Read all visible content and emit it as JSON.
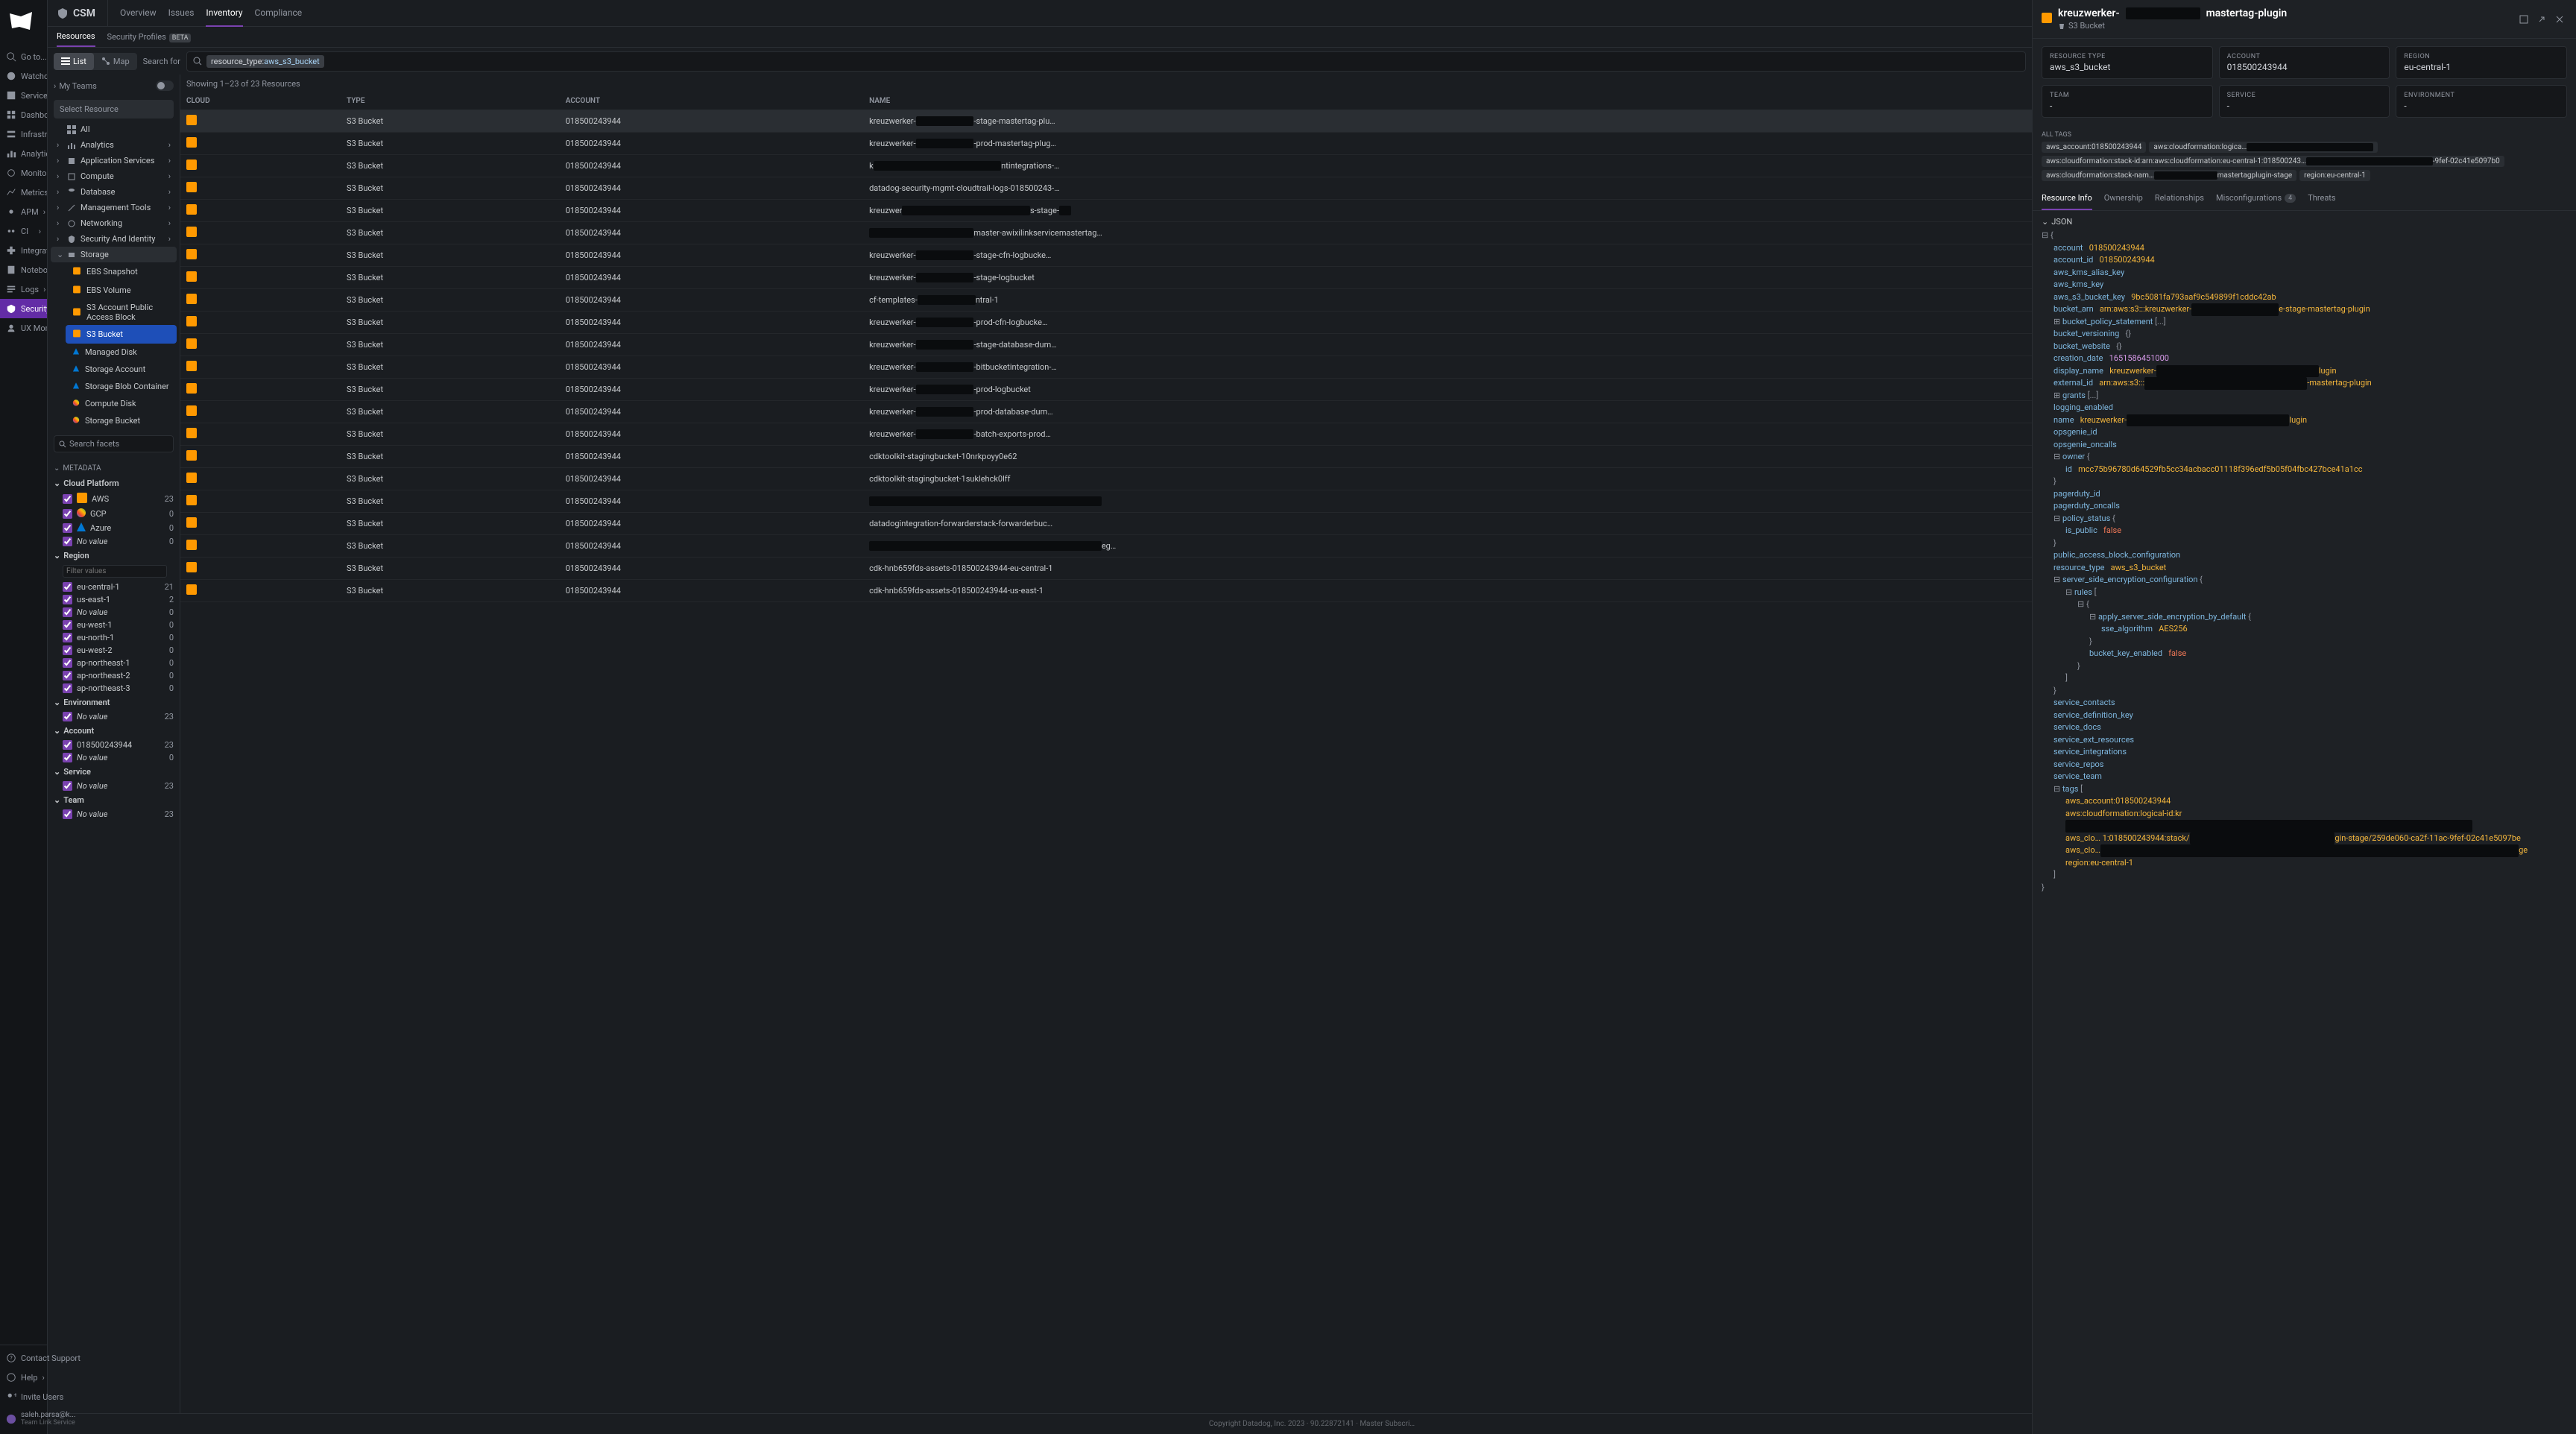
{
  "nav": {
    "items": [
      "Go to...",
      "Watchdog",
      "Service Mgmt",
      "Dashboards",
      "Infrastructure",
      "Analytics",
      "Monitors",
      "Metrics",
      "APM",
      "CI",
      "Integrations",
      "Notebooks",
      "Logs",
      "Security",
      "UX Monitoring"
    ],
    "bottom": [
      "Contact Support",
      "Help",
      "Invite Users"
    ],
    "user_email": "saleh.parsa@k...",
    "service_name": "Team Link Service"
  },
  "header": {
    "title": "CSM",
    "tabs": [
      "Overview",
      "Issues",
      "Inventory",
      "Compliance"
    ],
    "active_tab": "Inventory",
    "sub_tabs": [
      "Resources",
      "Security Profiles"
    ],
    "active_sub_tab": "Resources",
    "beta_label": "BETA"
  },
  "toolbar": {
    "view_list": "List",
    "view_map": "Map",
    "search_label": "Search for",
    "filter_key": "resource_type",
    "filter_value": "aws_s3_bucket"
  },
  "sidebar": {
    "breadcrumb_label": "My Teams",
    "select_resource": "Select Resource",
    "tree": [
      {
        "label": "All",
        "expandable": false
      },
      {
        "label": "Analytics",
        "expandable": true
      },
      {
        "label": "Application Services",
        "expandable": true
      },
      {
        "label": "Compute",
        "expandable": true
      },
      {
        "label": "Database",
        "expandable": true
      },
      {
        "label": "Management Tools",
        "expandable": true
      },
      {
        "label": "Networking",
        "expandable": true
      },
      {
        "label": "Security And Identity",
        "expandable": true
      },
      {
        "label": "Storage",
        "expandable": true,
        "active": true,
        "children": [
          {
            "label": "EBS Snapshot"
          },
          {
            "label": "EBS Volume"
          },
          {
            "label": "S3 Account Public Access Block"
          },
          {
            "label": "S3 Bucket",
            "active": true
          },
          {
            "label": "Managed Disk"
          },
          {
            "label": "Storage Account"
          },
          {
            "label": "Storage Blob Container"
          },
          {
            "label": "Compute Disk"
          },
          {
            "label": "Storage Bucket"
          }
        ]
      }
    ],
    "facet_search_placeholder": "Search facets",
    "metadata_label": "METADATA",
    "facets": {
      "cloud_platform": {
        "label": "Cloud Platform",
        "items": [
          {
            "name": "AWS",
            "count": 23,
            "icon": "aws"
          },
          {
            "name": "GCP",
            "count": 0,
            "icon": "gcp"
          },
          {
            "name": "Azure",
            "count": 0,
            "icon": "azure"
          },
          {
            "name": "No value",
            "count": 0
          }
        ]
      },
      "region": {
        "label": "Region",
        "filter_placeholder": "Filter values",
        "items": [
          {
            "name": "eu-central-1",
            "count": 21
          },
          {
            "name": "us-east-1",
            "count": 2
          },
          {
            "name": "No value",
            "count": 0
          },
          {
            "name": "eu-west-1",
            "count": 0
          },
          {
            "name": "eu-north-1",
            "count": 0
          },
          {
            "name": "eu-west-2",
            "count": 0
          },
          {
            "name": "ap-northeast-1",
            "count": 0
          },
          {
            "name": "ap-northeast-2",
            "count": 0
          },
          {
            "name": "ap-northeast-3",
            "count": 0
          }
        ]
      },
      "environment": {
        "label": "Environment",
        "items": [
          {
            "name": "No value",
            "count": 23
          }
        ]
      },
      "account": {
        "label": "Account",
        "items": [
          {
            "name": "018500243944",
            "count": 23
          },
          {
            "name": "No value",
            "count": 0
          }
        ]
      },
      "service": {
        "label": "Service",
        "items": [
          {
            "name": "No value",
            "count": 23
          }
        ]
      },
      "team": {
        "label": "Team",
        "items": [
          {
            "name": "No value",
            "count": 23
          }
        ]
      }
    }
  },
  "results": {
    "summary": "Showing 1–23 of 23 Resources",
    "columns": [
      "CLOUD",
      "TYPE",
      "ACCOUNT",
      "NAME"
    ],
    "rows": [
      {
        "type": "S3 Bucket",
        "account": "018500243944",
        "name": "kreuzwerker-██████████-stage-mastertag-plu…",
        "selected": true
      },
      {
        "type": "S3 Bucket",
        "account": "018500243944",
        "name": "kreuzwerker-██████████-prod-mastertag-plug…"
      },
      {
        "type": "S3 Bucket",
        "account": "018500243944",
        "name": "k██████████████████████ntintegrations-…"
      },
      {
        "type": "S3 Bucket",
        "account": "018500243944",
        "name": "datadog-security-mgmt-cloudtrail-logs-018500243-…"
      },
      {
        "type": "S3 Bucket",
        "account": "018500243944",
        "name": "kreuzwer██████████████████████s-stage-██"
      },
      {
        "type": "S3 Bucket",
        "account": "018500243944",
        "name": "██████████████████master-awixilinkservicemastertag…"
      },
      {
        "type": "S3 Bucket",
        "account": "018500243944",
        "name": "kreuzwerker-██████████-stage-cfn-logbucke…"
      },
      {
        "type": "S3 Bucket",
        "account": "018500243944",
        "name": "kreuzwerker-██████████-stage-logbucket"
      },
      {
        "type": "S3 Bucket",
        "account": "018500243944",
        "name": "cf-templates-██████████ntral-1"
      },
      {
        "type": "S3 Bucket",
        "account": "018500243944",
        "name": "kreuzwerker-██████████-prod-cfn-logbucke…"
      },
      {
        "type": "S3 Bucket",
        "account": "018500243944",
        "name": "kreuzwerker-██████████-stage-database-dum…"
      },
      {
        "type": "S3 Bucket",
        "account": "018500243944",
        "name": "kreuzwerker-██████████-bitbucketintegration-…"
      },
      {
        "type": "S3 Bucket",
        "account": "018500243944",
        "name": "kreuzwerker-██████████-prod-logbucket"
      },
      {
        "type": "S3 Bucket",
        "account": "018500243944",
        "name": "kreuzwerker-██████████-prod-database-dum…"
      },
      {
        "type": "S3 Bucket",
        "account": "018500243944",
        "name": "kreuzwerker-██████████-batch-exports-prod…"
      },
      {
        "type": "S3 Bucket",
        "account": "018500243944",
        "name": "cdktoolkit-stagingbucket-10nrkpoyy0e62"
      },
      {
        "type": "S3 Bucket",
        "account": "018500243944",
        "name": "cdktoolkit-stagingbucket-1suklehck0lff"
      },
      {
        "type": "S3 Bucket",
        "account": "018500243944",
        "name": "████████████████████████████████████████"
      },
      {
        "type": "S3 Bucket",
        "account": "018500243944",
        "name": "datadogintegration-forwarderstack-forwarderbuc…"
      },
      {
        "type": "S3 Bucket",
        "account": "018500243944",
        "name": "████████████████████████████████████████eg…"
      },
      {
        "type": "S3 Bucket",
        "account": "018500243944",
        "name": "cdk-hnb659fds-assets-018500243944-eu-central-1"
      },
      {
        "type": "S3 Bucket",
        "account": "018500243944",
        "name": "cdk-hnb659fds-assets-018500243944-us-east-1"
      }
    ]
  },
  "detail": {
    "title_prefix": "kreuzwerker-",
    "title_suffix": "mastertag-plugin",
    "subtitle": "S3 Bucket",
    "metadata": {
      "resource_type": {
        "label": "RESOURCE TYPE",
        "value": "aws_s3_bucket"
      },
      "account": {
        "label": "ACCOUNT",
        "value": "018500243944"
      },
      "region": {
        "label": "REGION",
        "value": "eu-central-1"
      },
      "team": {
        "label": "TEAM",
        "value": "-"
      },
      "service": {
        "label": "SERVICE",
        "value": "-"
      },
      "environment": {
        "label": "ENVIRONMENT",
        "value": "-"
      }
    },
    "all_tags_label": "ALL TAGS",
    "tags": [
      "aws_account:018500243944",
      "aws:cloudformation:logica…████████████████████████",
      "aws:cloudformation:stack-id:arn:aws:cloudformation:eu-central-1:018500243…████████████████████████-9fef-02c41e5097b0",
      "aws:cloudformation:stack-nam…████████████mastertagplugin-stage",
      "region:eu-central-1"
    ],
    "tabs": [
      {
        "label": "Resource Info",
        "active": true
      },
      {
        "label": "Ownership"
      },
      {
        "label": "Relationships"
      },
      {
        "label": "Misconfigurations",
        "badge": "4"
      },
      {
        "label": "Threats"
      }
    ],
    "json_label": "JSON",
    "json": {
      "account": "018500243944",
      "account_id": "018500243944",
      "aws_kms_alias_key": "",
      "aws_kms_key": "",
      "aws_s3_bucket_key": "9bc5081fa793aaf9c549899f1cddc42ab",
      "bucket_arn": "arn:aws:s3:::kreuzwerker-███████████████e-stage-mastertag-plugin",
      "bucket_policy_statement_ellipsis": "[...]",
      "bucket_versioning": "{}",
      "bucket_website": "{}",
      "creation_date": "1651586451000",
      "display_name": "kreuzwerker-████████████████████████████lugin",
      "external_id": "arn:aws:s3:::████████████████████████████-mastertag-plugin",
      "grants_ellipsis": "[...]",
      "logging_enabled": "",
      "name": "kreuzwerker-████████████████████████████lugin",
      "opsgenie_id": "",
      "opsgenie_oncalls": "",
      "owner_id": "mcc75b96780d64529fb5cc34acbacc01118f396edf5b05f04fbc427bce41a1cc",
      "pagerduty_id": "",
      "pagerduty_oncalls": "",
      "is_public": "false",
      "public_access_block_configuration": "",
      "resource_type": "aws_s3_bucket",
      "sse_algorithm": "AES256",
      "bucket_key_enabled": "false",
      "service_contacts": "",
      "service_definition_key": "",
      "service_docs": "",
      "service_ext_resources": "",
      "service_integrations": "",
      "service_repos": "",
      "service_team": "",
      "tag_aws_account": "aws_account:018500243944",
      "tag_cf_logical": "aws:cloudformation:logical-id:kr██████████████████████████████████████████████████████████████████████",
      "tag_aws_clo": "aws_clo… 1:018500243944:stack/█████████████████████████gin-stage/259de060-ca2f-11ac-9fef-02c41e5097be",
      "tag_aws_clo2": "aws_clo…████████████████████████████████████████████████████████████████████████ge",
      "tag_region": "region:eu-central-1"
    }
  },
  "footer": {
    "copyright": "Copyright Datadog, Inc. 2023",
    "version": "90.22872141",
    "msa_label": "Master Subscri…"
  }
}
